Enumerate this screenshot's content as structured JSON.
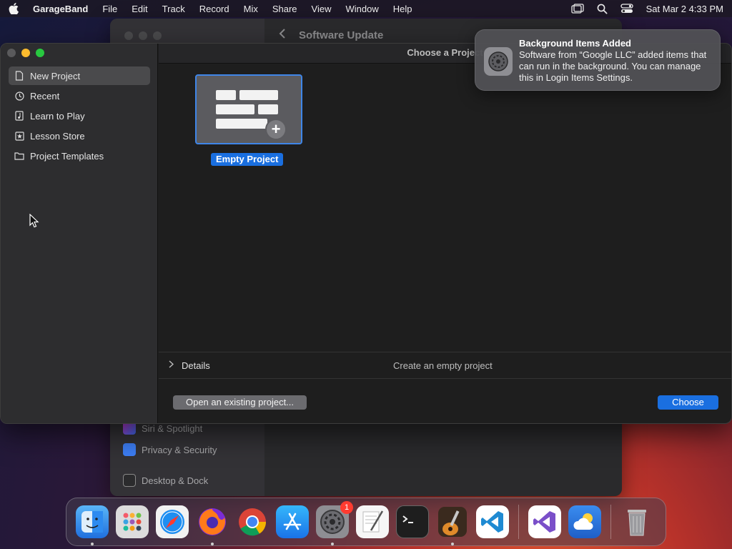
{
  "menubar": {
    "app_name": "GarageBand",
    "menus": [
      "File",
      "Edit",
      "Track",
      "Record",
      "Mix",
      "Share",
      "View",
      "Window",
      "Help"
    ],
    "clock": "Sat Mar 2  4:33 PM"
  },
  "background_window": {
    "title": "Software Update",
    "items": [
      "Siri & Spotlight",
      "Privacy & Security",
      "Desktop & Dock"
    ]
  },
  "dialog": {
    "header": "Choose a Project",
    "sidebar": [
      {
        "label": "New Project",
        "icon": "document-icon",
        "selected": true
      },
      {
        "label": "Recent",
        "icon": "clock-icon",
        "selected": false
      },
      {
        "label": "Learn to Play",
        "icon": "music-note-icon",
        "selected": false
      },
      {
        "label": "Lesson Store",
        "icon": "star-icon",
        "selected": false
      },
      {
        "label": "Project Templates",
        "icon": "folder-icon",
        "selected": false
      }
    ],
    "template_label": "Empty Project",
    "details_label": "Details",
    "details_description": "Create an empty project",
    "open_button": "Open an existing project...",
    "choose_button": "Choose"
  },
  "notification": {
    "title": "Background Items Added",
    "body": "Software from “Google LLC” added items that can run in the background. You can manage this in Login Items Settings."
  },
  "dock": {
    "system_settings_badge": "1"
  },
  "colors": {
    "accent": "#1a6fe0",
    "selected_sidebar": "#4a4a4c"
  }
}
